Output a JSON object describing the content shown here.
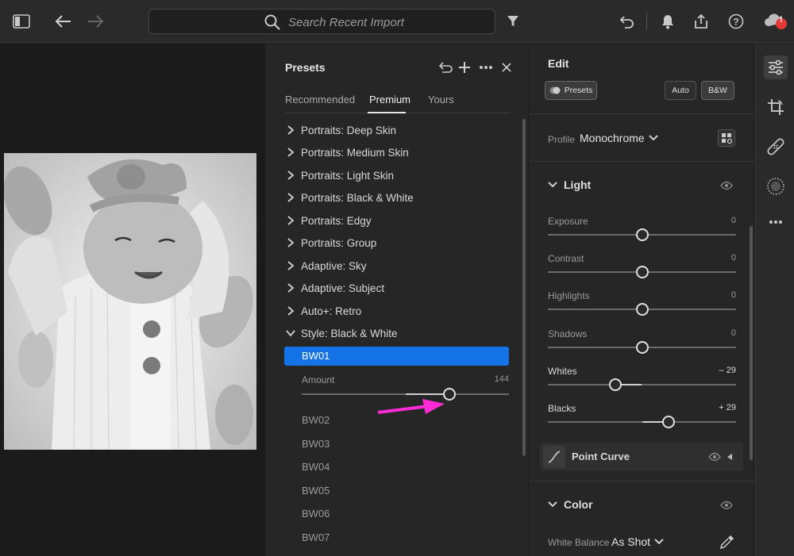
{
  "topbar": {
    "search_placeholder": "Search Recent Import",
    "sync_badge": "!"
  },
  "presets": {
    "title": "Presets",
    "tabs": [
      {
        "label": "Recommended"
      },
      {
        "label": "Premium"
      },
      {
        "label": "Yours"
      }
    ],
    "active_tab": "Premium",
    "groups": [
      {
        "label": "Portraits: Deep Skin"
      },
      {
        "label": "Portraits: Medium Skin"
      },
      {
        "label": "Portraits: Light Skin"
      },
      {
        "label": "Portraits: Black & White"
      },
      {
        "label": "Portraits: Edgy"
      },
      {
        "label": "Portraits: Group"
      },
      {
        "label": "Adaptive: Sky"
      },
      {
        "label": "Adaptive: Subject"
      },
      {
        "label": "Auto+: Retro"
      },
      {
        "label": "Style: Black & White"
      }
    ],
    "selected": "BW01",
    "amount": {
      "label": "Amount",
      "value": "144",
      "fraction": 0.72
    },
    "sub_items": [
      "BW02",
      "BW03",
      "BW04",
      "BW05",
      "BW06",
      "BW07"
    ]
  },
  "edit": {
    "title": "Edit",
    "presets_button": "Presets",
    "auto_button": "Auto",
    "bw_button": "B&W",
    "profile_label": "Profile",
    "profile_value": "Monochrome",
    "light_title": "Light",
    "sliders": [
      {
        "label": "Exposure",
        "value": "0",
        "position": 0.5
      },
      {
        "label": "Contrast",
        "value": "0",
        "position": 0.5
      },
      {
        "label": "Highlights",
        "value": "0",
        "position": 0.5
      },
      {
        "label": "Shadows",
        "value": "0",
        "position": 0.5
      },
      {
        "label": "Whites",
        "value": "– 29",
        "position": 0.36
      },
      {
        "label": "Blacks",
        "value": "+ 29",
        "position": 0.64
      }
    ],
    "point_curve": "Point Curve",
    "color_title": "Color",
    "wb_label": "White Balance",
    "wb_value": "As Shot"
  },
  "colors": {
    "accent": "#1473e6",
    "annotation_arrow": "#ff2bd6",
    "badge": "#e53935"
  }
}
